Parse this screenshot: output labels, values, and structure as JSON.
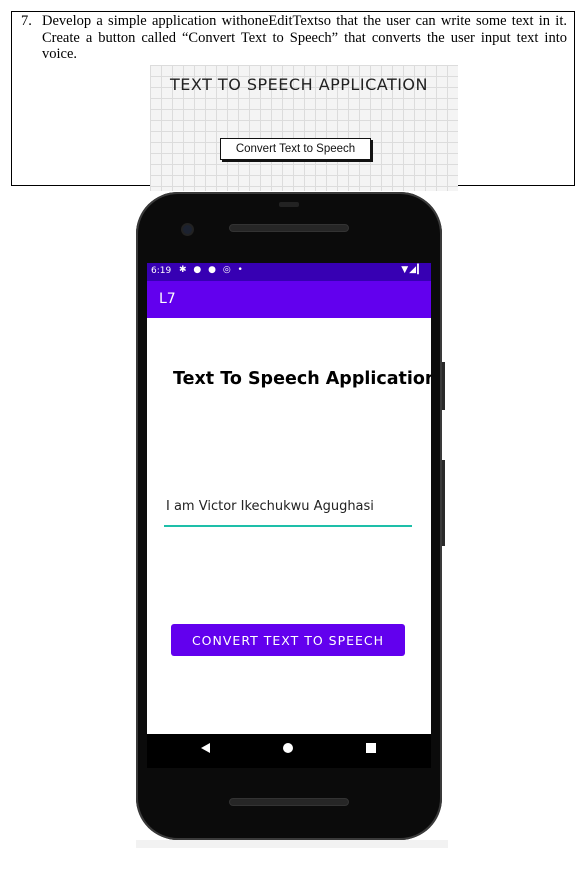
{
  "question": {
    "number": "7.",
    "text": "Develop a simple application withoneEditTextso that the user can write some text in it. Create a button called “Convert Text to Speech” that converts the user input text into voice."
  },
  "mockup": {
    "title": "TEXT TO SPEECH APPLICATION",
    "button_label": "Convert Text to Speech"
  },
  "phone": {
    "status_bar": {
      "time": "6:19",
      "left_icons": "✱ ● ● ◎ •",
      "right_icons": "▼◢▎"
    },
    "app_bar_title": "L7",
    "heading": "Text To Speech Application",
    "input_value": "I am Victor Ikechukwu Agughasi",
    "convert_button": "CONVERT TEXT TO SPEECH"
  },
  "colors": {
    "status_bar": "#3700b3",
    "app_bar": "#6200ee",
    "button": "#6200ee",
    "input_underline": "#1ebfa9"
  }
}
